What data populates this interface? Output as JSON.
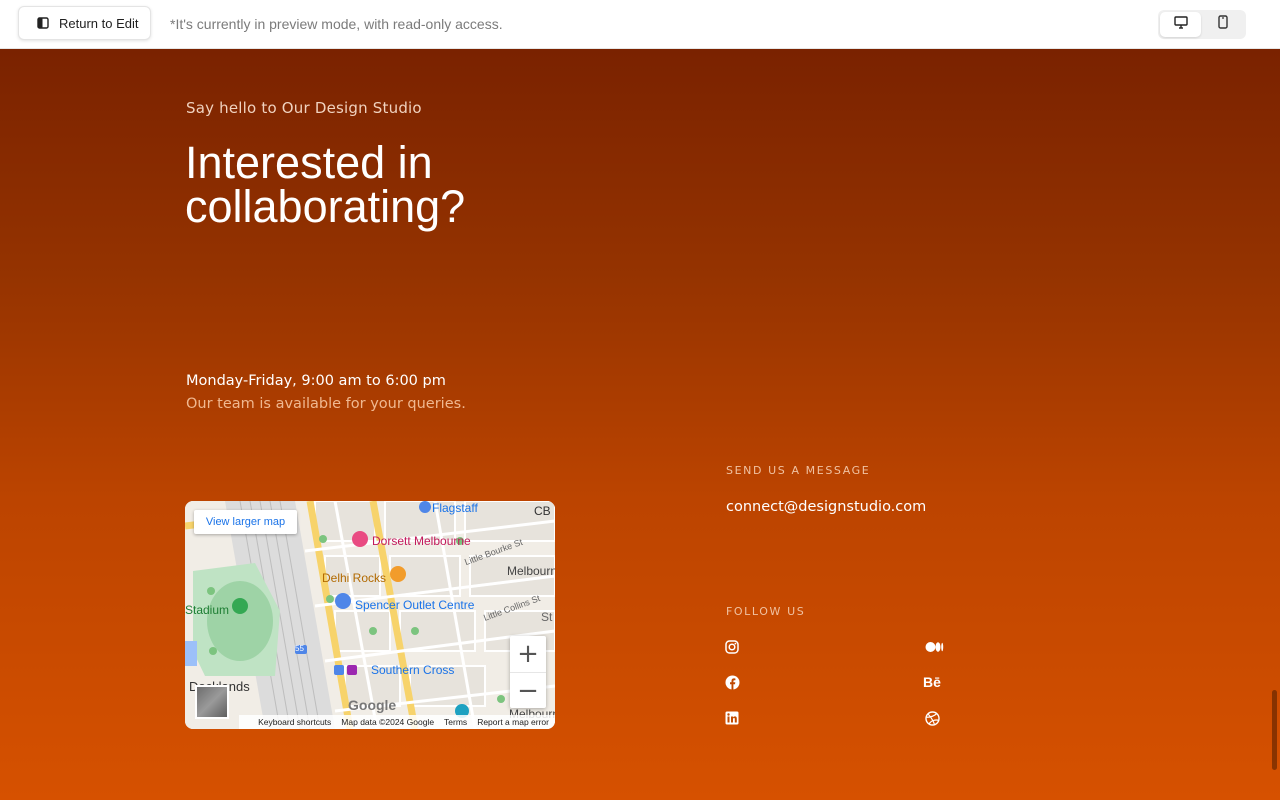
{
  "topbar": {
    "return_label": "Return to Edit",
    "preview_note": "*It's currently in preview mode, with read-only access.",
    "devices": [
      "desktop-icon",
      "mobile-icon"
    ],
    "active_device": "desktop"
  },
  "hero": {
    "eyebrow": "Say hello to Our Design Studio",
    "headline_line1": "Interested in",
    "headline_line2": "collaborating?"
  },
  "hours": {
    "time": "Monday-Friday, 9:00 am to 6:00 pm",
    "note": "Our team is available for your queries."
  },
  "map": {
    "view_larger": "View larger map",
    "labels": {
      "flagstaff": "Flagstaff",
      "dorsett": "Dorsett Melbourne",
      "little_bourke": "Little Bourke St",
      "delhi_rocks": "Delhi Rocks",
      "melbourne": "Melbourn",
      "stadium": "Stadium",
      "spencer_outlet": "Spencer Outlet Centre",
      "little_collins": "Little Collins St",
      "southern_cross": "Southern Cross",
      "docklands": "Docklands",
      "melbourne_bottom": "Melbourn",
      "cb": "CB",
      "route": "55",
      "st": "St"
    },
    "google": "Google",
    "footer": {
      "shortcuts": "Keyboard shortcuts",
      "data": "Map data ©2024 Google",
      "terms": "Terms",
      "report": "Report a map error"
    },
    "zoom_in": "+",
    "zoom_out": "−"
  },
  "contact": {
    "send_title": "SEND US A MESSAGE",
    "email": "connect@designstudio.com",
    "follow_title": "FOLLOW US",
    "socials": [
      "instagram-icon",
      "medium-icon",
      "facebook-icon",
      "behance-icon",
      "linkedin-icon",
      "dribbble-icon"
    ],
    "behance_text": "Bē"
  },
  "colors": {
    "gradient_top": "#7a2200",
    "gradient_bottom": "#d65100",
    "map_link": "#1a73e8"
  }
}
